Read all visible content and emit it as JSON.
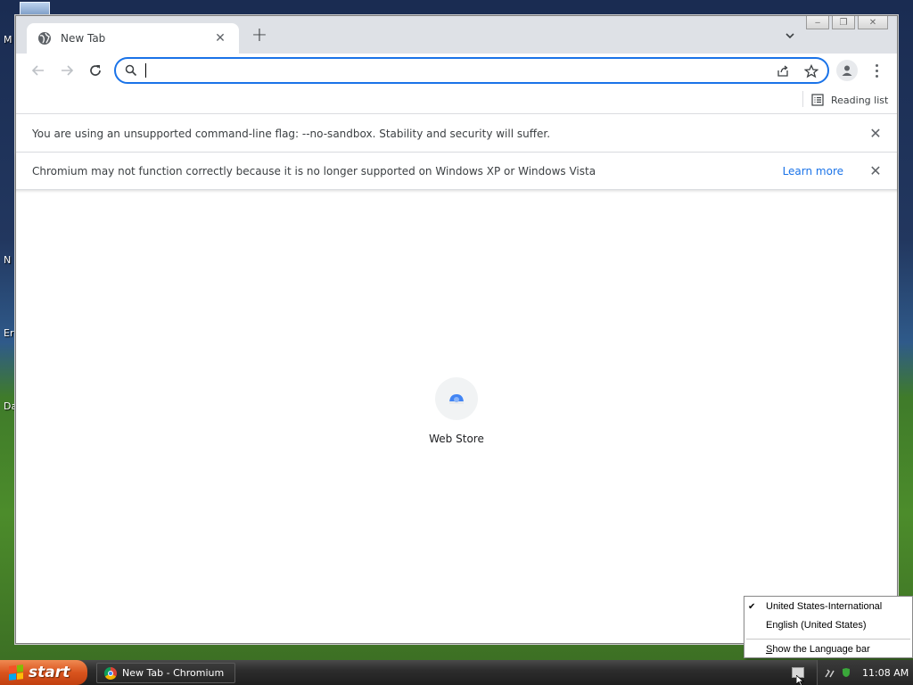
{
  "desktop": {
    "labels": [
      "M",
      "N",
      "Er",
      "Da"
    ]
  },
  "window": {
    "controls": {
      "minimize": "‒",
      "restore": "❐",
      "close": "✕"
    }
  },
  "tab": {
    "title": "New Tab",
    "icon": "globe-icon",
    "close_glyph": "✕"
  },
  "new_tab_glyph": "+",
  "toolbar": {
    "back_icon": "arrow-left-icon",
    "forward_icon": "arrow-right-icon",
    "reload_icon": "reload-icon",
    "omnibox": {
      "value": "",
      "placeholder": ""
    },
    "share_icon": "share-icon",
    "star_icon": "star-icon",
    "profile_icon": "profile-icon",
    "menu_icon": "kebab-menu-icon"
  },
  "bookmark_bar": {
    "reading_list_label": "Reading list"
  },
  "infobars": [
    {
      "message": "You are using an unsupported command-line flag: --no-sandbox. Stability and security will suffer.",
      "link": ""
    },
    {
      "message": "Chromium may not function correctly because it is no longer supported on Windows XP or Windows Vista",
      "link": "Learn more"
    }
  ],
  "shortcut": {
    "label": "Web Store",
    "icon": "web-store-icon"
  },
  "language_menu": {
    "items": [
      {
        "label": "United States-International",
        "checked": true
      },
      {
        "label": "English (United States)",
        "checked": false
      }
    ],
    "show_bar_prefix": "S",
    "show_bar_rest": "how the Language bar"
  },
  "taskbar": {
    "start_label": "start",
    "task_button_label": "New Tab - Chromium",
    "clock": "11:08 AM"
  },
  "colors": {
    "accent": "#1a73e8",
    "start_button": "#d9541e",
    "tab_strip": "#dee1e6"
  }
}
